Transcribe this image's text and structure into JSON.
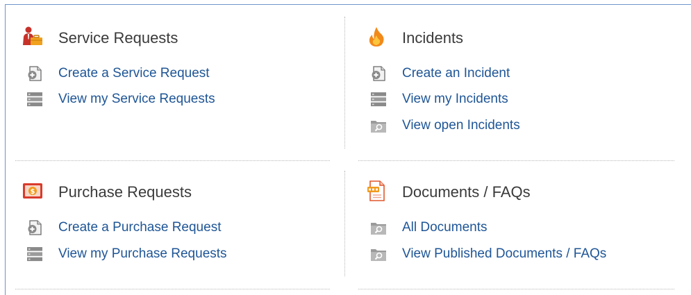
{
  "sections": [
    {
      "title": "Service Requests",
      "icon": "person-briefcase-icon",
      "items": [
        {
          "label": "Create a Service Request",
          "icon": "create-document-icon"
        },
        {
          "label": "View my Service Requests",
          "icon": "list-view-icon"
        }
      ]
    },
    {
      "title": "Incidents",
      "icon": "fire-icon",
      "items": [
        {
          "label": "Create an Incident",
          "icon": "create-document-icon"
        },
        {
          "label": "View my Incidents",
          "icon": "list-view-icon"
        },
        {
          "label": "View open Incidents",
          "icon": "folder-search-icon"
        }
      ]
    },
    {
      "title": "Purchase Requests",
      "icon": "money-icon",
      "items": [
        {
          "label": "Create a Purchase Request",
          "icon": "create-document-icon"
        },
        {
          "label": "View my Purchase Requests",
          "icon": "list-view-icon"
        }
      ]
    },
    {
      "title": "Documents / FAQs",
      "icon": "document-icon",
      "items": [
        {
          "label": "All Documents",
          "icon": "folder-search-icon"
        },
        {
          "label": "View Published Documents / FAQs",
          "icon": "folder-search-icon"
        }
      ]
    }
  ],
  "colors": {
    "link": "#1e5596",
    "heading": "#3a3a3a",
    "frame_border": "#6f94c9",
    "divider": "#b7b7b7"
  }
}
